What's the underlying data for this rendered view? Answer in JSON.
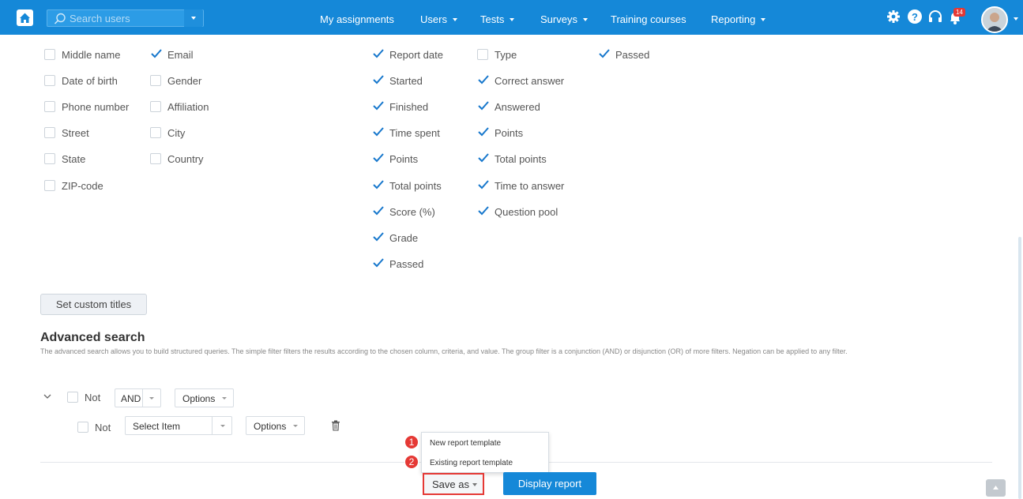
{
  "colors": {
    "accent": "#1588d8",
    "checkbox_check": "#1677cc",
    "highlight": "#e53935"
  },
  "topbar": {
    "search_placeholder": "Search users",
    "nav": [
      "My assignments",
      "Users",
      "Tests",
      "Surveys",
      "Training courses",
      "Reporting"
    ],
    "notification_count": "14",
    "icons": [
      "home-icon",
      "search-icon",
      "gear-icon",
      "help-icon",
      "headset-icon",
      "bell-icon",
      "user-avatar"
    ]
  },
  "user_columns": [
    {
      "label": "Middle name",
      "checked": false
    },
    {
      "label": "Email",
      "checked": true
    },
    {
      "label": "Date of birth",
      "checked": false
    },
    {
      "label": "Gender",
      "checked": false
    },
    {
      "label": "Phone number",
      "checked": false
    },
    {
      "label": "Affiliation",
      "checked": false
    },
    {
      "label": "Street",
      "checked": false
    },
    {
      "label": "City",
      "checked": false
    },
    {
      "label": "State",
      "checked": false
    },
    {
      "label": "Country",
      "checked": false
    },
    {
      "label": "ZIP-code",
      "checked": false
    }
  ],
  "test_columns": [
    {
      "label": "Report date",
      "checked": true
    },
    {
      "label": "Started",
      "checked": true
    },
    {
      "label": "Finished",
      "checked": true
    },
    {
      "label": "Time spent",
      "checked": true
    },
    {
      "label": "Points",
      "checked": true
    },
    {
      "label": "Total points",
      "checked": true
    },
    {
      "label": "Score (%)",
      "checked": true
    },
    {
      "label": "Grade",
      "checked": true
    },
    {
      "label": "Passed",
      "checked": true
    }
  ],
  "question_columns": [
    {
      "label": "Type",
      "checked": false
    },
    {
      "label": "Correct answer",
      "checked": true
    },
    {
      "label": "Answered",
      "checked": true
    },
    {
      "label": "Points",
      "checked": true
    },
    {
      "label": "Total points",
      "checked": true
    },
    {
      "label": "Time to answer",
      "checked": true
    },
    {
      "label": "Question pool",
      "checked": true
    }
  ],
  "other_columns": [
    {
      "label": "Passed",
      "checked": true
    }
  ],
  "set_custom_titles": "Set custom titles",
  "advanced": {
    "title": "Advanced search",
    "description": "The advanced search allows you to build structured queries. The simple filter filters the results according to the chosen column, criteria, and value. The group filter is a conjunction (AND) or disjunction (OR) of more filters. Negation can be applied to any filter.",
    "group": {
      "not_label": "Not",
      "operator": "AND",
      "options_label": "Options"
    },
    "filter": {
      "not_label": "Not",
      "select_placeholder": "Select Item",
      "options_label": "Options"
    }
  },
  "save_menu": {
    "items": [
      {
        "marker": "1",
        "label": "New report template"
      },
      {
        "marker": "2",
        "label": "Existing report template"
      }
    ]
  },
  "footer": {
    "save_as": "Save as",
    "display_report": "Display report"
  }
}
